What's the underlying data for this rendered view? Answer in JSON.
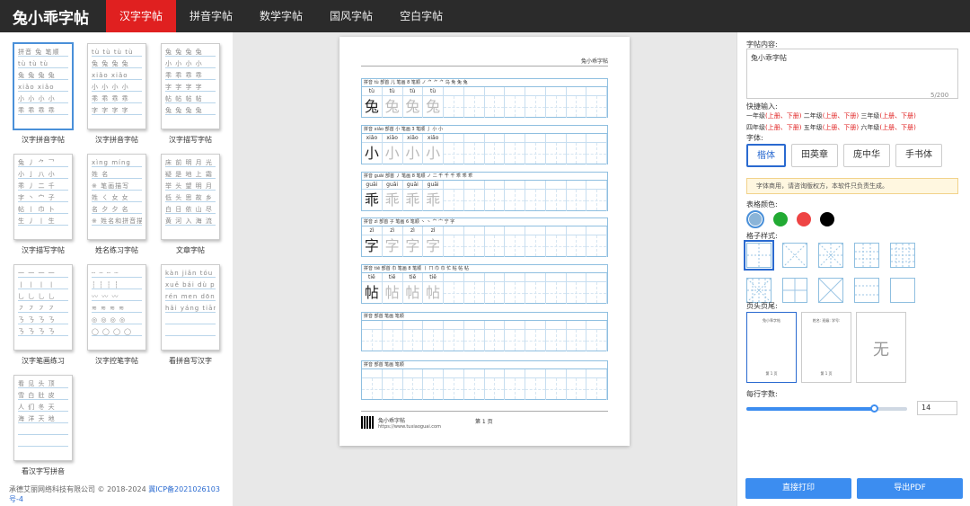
{
  "app": {
    "brand": "兔小乖字帖"
  },
  "nav": {
    "tabs": [
      "汉字字帖",
      "拼音字帖",
      "数学字帖",
      "国风字帖",
      "空白字帖"
    ],
    "active": 0
  },
  "templates": [
    {
      "label": "汉字拼音字帖",
      "selected": true,
      "sample": [
        "拼音 兔  笔顺",
        "tù  tù  tù",
        "兔 兔 兔 兔",
        "xiǎo xiǎo",
        "小 小 小 小",
        "乖 乖 乖 乖"
      ]
    },
    {
      "label": "汉字拼音字帖",
      "sample": [
        "tù tù tù tù",
        "兔 兔 兔 兔",
        "xiǎo xiǎo",
        "小 小 小 小",
        "乖 乖 乖 乖",
        "字 字 字 字"
      ]
    },
    {
      "label": "汉字描写字帖",
      "sample": [
        "兔 兔 兔 兔",
        "小 小 小 小",
        "乖 乖 乖 乖",
        "字 字 字 字",
        "帖 帖 帖 帖",
        "兔 兔 兔 兔"
      ]
    },
    {
      "label": "汉字描写字帖",
      "sample": [
        "兔 丿 ⺈ 乛",
        "小 亅 八 小",
        "乖 丿 二 千",
        "字 丶 宀 子",
        "帖 丨 巾 卜",
        "生 丿 丨 生"
      ]
    },
    {
      "label": "姓名练习字帖",
      "sample": [
        "xìng míng",
        "姓 名",
        "※ 笔画描写",
        "姓 ㄑ 女 女",
        "名 夕 夕 名",
        "※ 姓名和拼音描写"
      ]
    },
    {
      "label": "文章字帖",
      "sample": [
        "床 前 明 月 光",
        "疑 是 地 上 霜",
        "举 头 望 明 月",
        "低 头 思 故 乡",
        "白 日 依 山 尽",
        "黄 河 入 海 流"
      ]
    },
    {
      "label": "汉字笔画练习",
      "sample": [
        "一 一 一 一",
        "丨 丨 丨 丨",
        "乚 乚 乚 乚",
        "㇇ ㇇ ㇇ ㇇",
        "ㄋ ㄋ ㄋ ㄋ",
        "ㄋ ㄋ ㄋ ㄋ"
      ]
    },
    {
      "label": "汉字控笔字帖",
      "sample": [
        "┄ ┄ ┄ ┄",
        "┆ ┆ ┆ ┆",
        "〰 〰 〰",
        "≋ ≋ ≋ ≋",
        "◎ ◎ ◎ ◎",
        "◯ ◯ ◯ ◯"
      ]
    },
    {
      "label": "看拼音写汉字",
      "sample": [
        "kàn  jiǎn   tóu dǐng",
        "xuě  bái    dù  pí",
        "rén  men   dōng tiān",
        "hǎi yáng  tiān  dì",
        "",
        ""
      ]
    },
    {
      "label": "看汉字写拼音",
      "sample": [
        "看 见  头 顶",
        "雪 白  肚 皮",
        "人 们  冬 天",
        "海 洋  天 地",
        "",
        ""
      ]
    }
  ],
  "footer": {
    "copyright": "承德艾丽网络科技有限公司 © 2018-2024",
    "icp": "冀ICP备2021026103号-4"
  },
  "paper": {
    "header": "兔小乖字帖",
    "rows": [
      {
        "info": "拼音 tù  部首 儿  笔画 8  笔顺  ノ ⺈ ⺈ ⺈ 乌 免 兔 兔",
        "char": "兔",
        "pinyin": "tù"
      },
      {
        "info": "拼音 xiǎo  部首 小  笔画 3  笔顺  亅 小 小",
        "char": "小",
        "pinyin": "xiǎo"
      },
      {
        "info": "拼音 guāi  部首 丿  笔画 8  笔顺  ノ 二 千 千 千 乖 乖 乖",
        "char": "乖",
        "pinyin": "guāi"
      },
      {
        "info": "拼音 zì  部首 子  笔画 6  笔顺  丶 丶 宀 宀 宁 字",
        "char": "字",
        "pinyin": "zì"
      },
      {
        "info": "拼音 tiē  部首 巾  笔画 8  笔顺  丨 ㄇ 巾 巾 忙 帖 帖 帖",
        "char": "帖",
        "pinyin": "tiē"
      },
      {
        "info": "拼音   部首   笔画   笔顺",
        "char": "",
        "pinyin": ""
      },
      {
        "info": "拼音   部首   笔画   笔顺",
        "char": "",
        "pinyin": ""
      }
    ],
    "footer_name": "兔小乖字帖",
    "footer_url": "https://www.tuxiaoguai.com",
    "page": "第 1 页"
  },
  "panel": {
    "content_label": "字帖内容:",
    "content_value": "兔小乖字帖",
    "counter": "5/200",
    "quick_label": "快捷输入:",
    "quick_rows": [
      [
        {
          "g": "一年级",
          "u": "(上册、下册)"
        },
        {
          "g": "二年级",
          "u": "(上册、下册)"
        },
        {
          "g": "三年级",
          "u": "(上册、下册)"
        }
      ],
      [
        {
          "g": "四年级",
          "u": "(上册、下册)"
        },
        {
          "g": "五年级",
          "u": "(上册、下册)"
        },
        {
          "g": "六年级",
          "u": "(上册、下册)"
        }
      ]
    ],
    "font_label": "字体:",
    "fonts": [
      "楷体",
      "田英章",
      "庞中华",
      "手书体"
    ],
    "font_selected": 0,
    "notice": "字体商用，请咨询版权方，本软件只负责生成。",
    "color_label": "表格颜色:",
    "colors": [
      "#8ab4d8",
      "#22aa33",
      "#ee4444",
      "#000000"
    ],
    "color_selected": 0,
    "grid_label": "格子样式:",
    "hf_label": "页头页尾:",
    "hf_options": [
      {
        "top": "兔小乖字帖",
        "bottom": "第 1 页"
      },
      {
        "top": "姓名:   班级:   学号:",
        "bottom": "第 1 页"
      },
      {
        "none": "无"
      }
    ],
    "per_row_label": "每行字数:",
    "per_row_value": "14",
    "per_row_fraction": 0.8,
    "print_button": "直接打印",
    "pdf_button": "导出PDF"
  }
}
